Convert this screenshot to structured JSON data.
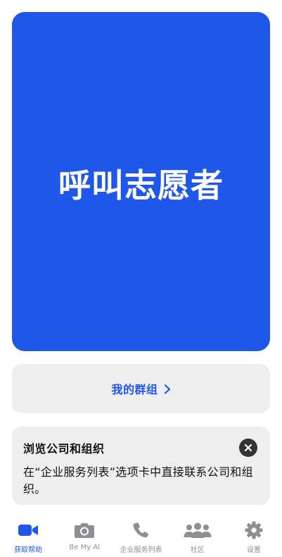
{
  "call_card": {
    "label": "呼叫志愿者"
  },
  "groups_card": {
    "label": "我的群组"
  },
  "info_card": {
    "title": "浏览公司和组织",
    "body": "在“企业服务列表”选项卡中直接联系公司和组织。"
  },
  "tabbar": {
    "tabs": [
      {
        "label": "获取帮助",
        "icon": "video-camera-icon",
        "active": true
      },
      {
        "label": "Be My AI",
        "icon": "camera-icon",
        "active": false
      },
      {
        "label": "企业服务列表",
        "icon": "phone-icon",
        "active": false
      },
      {
        "label": "社区",
        "icon": "people-icon",
        "active": false
      },
      {
        "label": "设置",
        "icon": "gear-icon",
        "active": false
      }
    ]
  },
  "colors": {
    "accent": "#1f57ea",
    "card_background": "#eeeeef",
    "inactive": "#8e8e93"
  }
}
